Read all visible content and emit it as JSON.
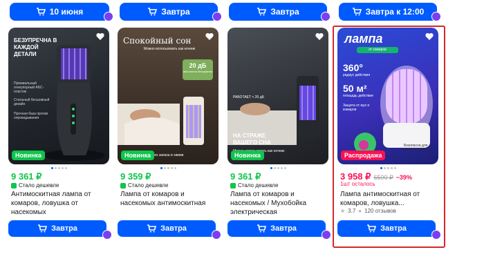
{
  "top_buttons": [
    {
      "label": "10 июня"
    },
    {
      "label": "Завтра"
    },
    {
      "label": "Завтра"
    },
    {
      "label": "Завтра к 12:00"
    }
  ],
  "cards": [
    {
      "image_text": {
        "headline": "БЕЗУПРЕЧНА В КАЖДОЙ ДЕТАЛИ",
        "line1": "Премиальный огнеупорный АБС-пластик",
        "line2": "Стильный бесшовный дизайн",
        "line3": "Прочная база против опрокидывания"
      },
      "tag": "Новинка",
      "price": "9 361 ₽",
      "cheaper": "Стало дешевле",
      "title": "Антимоскитная лампа от комаров, ловушка от насекомых",
      "cart_label": "Завтра"
    },
    {
      "image_text": {
        "headline": "Спокойный сон",
        "sub": "Можно использовать как ночник",
        "noise": "20 дБ",
        "noise_sub": "абсолютно бесшумная",
        "bottom": "без запаха и химии"
      },
      "tag": "Новинка",
      "price": "9 359 ₽",
      "cheaper": "Стало дешевле",
      "title": "Лампа от комаров и насекомых антимоскитная",
      "cart_label": "Завтра"
    },
    {
      "image_text": {
        "sub": "РАБОТАЕТ < 20 дБ",
        "headline": "НА СТРАЖЕ ВАШЕГО СНА",
        "bottom": "Можно использовать как ночник"
      },
      "tag": "Новинка",
      "price": "9 361 ₽",
      "cheaper": "Стало дешевле",
      "title": "Лампа от комаров и насекомых / Мухобойка электрическая",
      "cart_label": "Завтра"
    },
    {
      "image_text": {
        "headline": "лампа",
        "sub": "от комаров",
        "stat1": "360°",
        "stat1_sub": "радиус действия",
        "stat2": "50 м²",
        "stat2_sub": "площадь действия",
        "note": "Защита от мух и комаров",
        "note2": "Безопасна для детей и животных"
      },
      "tag": "Распродажа",
      "price": "3 958 ₽",
      "old_price": "6500 ₽",
      "discount": "−39%",
      "left": "1шт осталось",
      "title": "Лампа антимоскитная от комаров, ловушка...",
      "rating": "3.7",
      "reviews": "120 отзывов",
      "cart_label": "Завтра"
    }
  ],
  "colors": {
    "accent": "#005bff",
    "price_green": "#10c44c",
    "price_red": "#f91155",
    "new_tag": "#10c44c",
    "sale_tag": "#f91155",
    "highlight": "#d5262a"
  }
}
